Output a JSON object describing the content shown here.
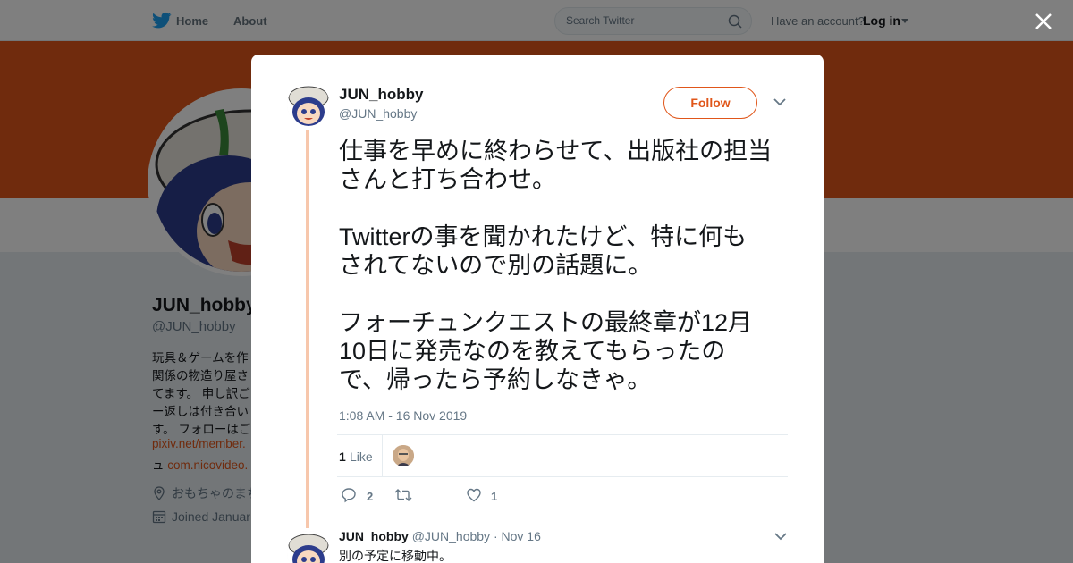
{
  "topbar": {
    "home_label": "Home",
    "about_label": "About",
    "search_placeholder": "Search Twitter",
    "have_account": "Have an account?",
    "login_label": "Log in"
  },
  "profile": {
    "name": "JUN_hobby",
    "handle": "@JUN_hobby",
    "bio_lines": [
      "玩具＆ゲームを作",
      "関係の物造り屋さ",
      "てます。 申し訳ご",
      "ー返しは付き合い",
      "す。 フォローはご"
    ],
    "link1": "pixiv.net/member.",
    "link2_prefix": "ュ ",
    "link2": "com.nicovideo.",
    "location": "おもちゃのまち",
    "joined": "Joined Januar",
    "banner_color": "#e0561a"
  },
  "tweet": {
    "name": "JUN_hobby",
    "handle": "@JUN_hobby",
    "follow_label": "Follow",
    "text_lines": [
      "仕事を早めに終わらせて、出版社の担当",
      "さんと打ち合わせ。",
      "",
      "Twitterの事を聞かれたけど、特に何も",
      "されてないので別の話題に。",
      "",
      "フォーチュンクエストの最終章が12月",
      "10日に発売なのを教えてもらったの",
      "で、帰ったら予約しなきゃ。"
    ],
    "timestamp": "1:08 AM - 16 Nov 2019",
    "like_count": "1",
    "like_label": "Like",
    "reply_count": "2",
    "retweet_count": "",
    "favorite_count": "1",
    "accent_color": "#e0561a"
  },
  "reply": {
    "name": "JUN_hobby",
    "handle": "@JUN_hobby",
    "separator": "·",
    "date": "Nov 16",
    "text": "別の予定に移動中。"
  },
  "icons": [
    "twitter-bird-icon",
    "search-icon",
    "close-icon",
    "chevron-down-icon",
    "reply-icon",
    "retweet-icon",
    "heart-icon",
    "location-icon",
    "calendar-icon"
  ]
}
